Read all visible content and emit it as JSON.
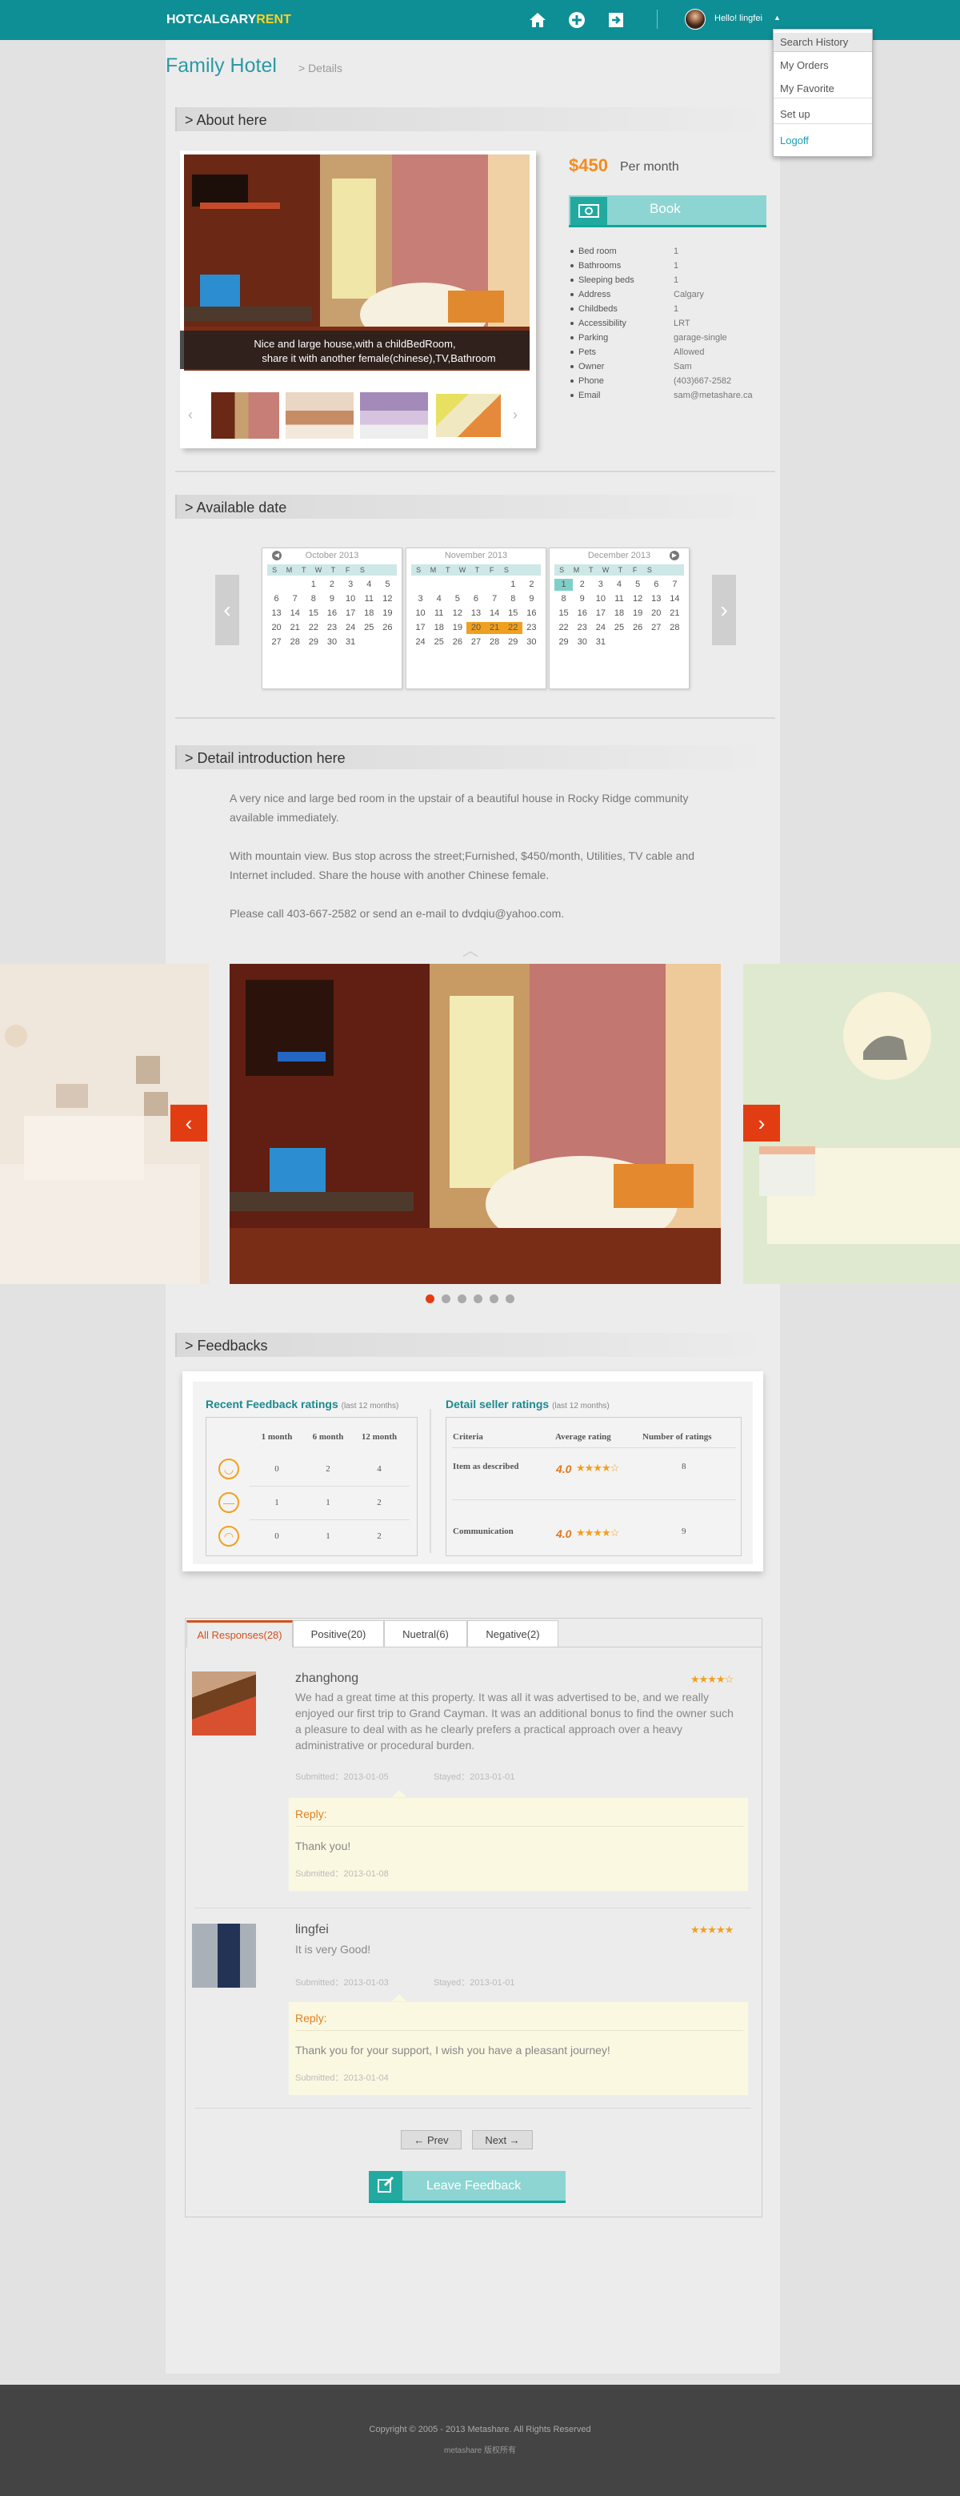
{
  "header": {
    "logo_main": "HOTCALGARY",
    "logo_accent": "RENT",
    "greeting": "Hello! lingfei",
    "icons": [
      "home-icon",
      "add-icon",
      "login-icon"
    ]
  },
  "user_menu": {
    "items": [
      "Search History",
      "My Orders",
      "My Favorite",
      "Set up",
      "Logoff"
    ]
  },
  "page": {
    "title": "Family Hotel",
    "breadcrumb": "> Details"
  },
  "about": {
    "section_title": "> About here",
    "caption_line1": "Nice and large house,with a childBedRoom,",
    "caption_line2": "share it with another female(chinese),TV,Bathroom",
    "price": "$450",
    "price_unit": "Per month",
    "book_label": "Book",
    "facts": [
      {
        "key": "Bed room",
        "value": "1"
      },
      {
        "key": "Bathrooms",
        "value": "1"
      },
      {
        "key": "Sleeping beds",
        "value": "1"
      },
      {
        "key": "Address",
        "value": "Calgary"
      },
      {
        "key": "Childbeds",
        "value": "1"
      },
      {
        "key": "Accessibility",
        "value": "LRT"
      },
      {
        "key": "Parking",
        "value": "garage-single"
      },
      {
        "key": "Pets",
        "value": "Allowed"
      },
      {
        "key": "Owner",
        "value": "Sam"
      },
      {
        "key": "Phone",
        "value": "(403)667-2582"
      },
      {
        "key": "Email",
        "value": "sam@metashare.ca"
      }
    ]
  },
  "available": {
    "section_title": "> Available date",
    "weekdays": [
      "S",
      "M",
      "T",
      "W",
      "T",
      "F",
      "S"
    ],
    "months": [
      {
        "label": "October 2013",
        "offset": 2,
        "days": 31,
        "highlight": [],
        "today": null
      },
      {
        "label": "November 2013",
        "offset": 5,
        "days": 30,
        "highlight": [
          20,
          21,
          22
        ],
        "today": null
      },
      {
        "label": "December 2013",
        "offset": 0,
        "days": 31,
        "highlight": [],
        "today": 1
      }
    ]
  },
  "detail": {
    "section_title": "> Detail introduction here",
    "paragraph1": "A very nice and large bed room in the upstair of a beautiful house in Rocky Ridge community available immediately.",
    "paragraph2": "With mountain view. Bus stop across the street;Furnished, $450/month, Utilities, TV cable and Internet included. Share the house with another Chinese female.",
    "paragraph3": "Please call 403-667-2582 or send an e-mail to dvdqiu@yahoo.com."
  },
  "gallery": {
    "slide_count": 6,
    "active_slide": 1
  },
  "feedbacks": {
    "section_title": "> Feedbacks",
    "recent_title": "Recent Feedback ratings",
    "recent_sub": "(last 12 months)",
    "periods": [
      "1 month",
      "6 month",
      "12 month"
    ],
    "rows": [
      {
        "icon": "happy-face-icon",
        "values": [
          "0",
          "2",
          "4"
        ]
      },
      {
        "icon": "neutral-face-icon",
        "values": [
          "1",
          "1",
          "2"
        ]
      },
      {
        "icon": "sad-face-icon",
        "values": [
          "0",
          "1",
          "2"
        ]
      }
    ],
    "seller_title": "Detail seller ratings",
    "seller_sub": "(last 12 months)",
    "seller_headers": [
      "Criteria",
      "Average rating",
      "Number of ratings"
    ],
    "seller_rows": [
      {
        "criteria": "Item as described",
        "rating": "4.0",
        "stars": 4,
        "count": "8"
      },
      {
        "criteria": "Communication",
        "rating": "4.0",
        "stars": 4,
        "count": "9"
      }
    ]
  },
  "responses": {
    "tabs": [
      "All Responses(28)",
      "Positive(20)",
      "Nuetral(6)",
      "Negative(2)"
    ],
    "reviews": [
      {
        "name": "zhanghong",
        "stars": 4,
        "text": "We had a great time at this property. It was all it was advertised to be, and we really enjoyed our first trip to Grand Cayman. It was an additional bonus to find the owner such a pleasure to deal with as he clearly prefers a practical approach over a heavy administrative or procedural burden.",
        "submitted": "Submitted：2013-01-05",
        "stayed": "Stayed：2013-01-01",
        "reply_label": "Reply:",
        "reply_text": "Thank you!",
        "reply_submitted": "Submitted：2013-01-08"
      },
      {
        "name": "lingfei",
        "stars": 5,
        "text": "It is very Good!",
        "submitted": "Submitted：2013-01-03",
        "stayed": "Stayed：2013-01-01",
        "reply_label": "Reply:",
        "reply_text": "Thank you for your support, I wish you have a pleasant journey!",
        "reply_submitted": "Submitted：2013-01-04"
      }
    ],
    "prev_label": "← Prev",
    "next_label": "Next →",
    "leave_label": "Leave Feedback"
  },
  "footer": {
    "copyright": "Copyright © 2005 - 2013 Metashare. All Rights Reserved",
    "cn_line": "metashare 版权所有"
  },
  "colors": {
    "teal": "#0e8f96",
    "accent_orange": "#f28d1f",
    "slider_red": "#e23d12"
  }
}
